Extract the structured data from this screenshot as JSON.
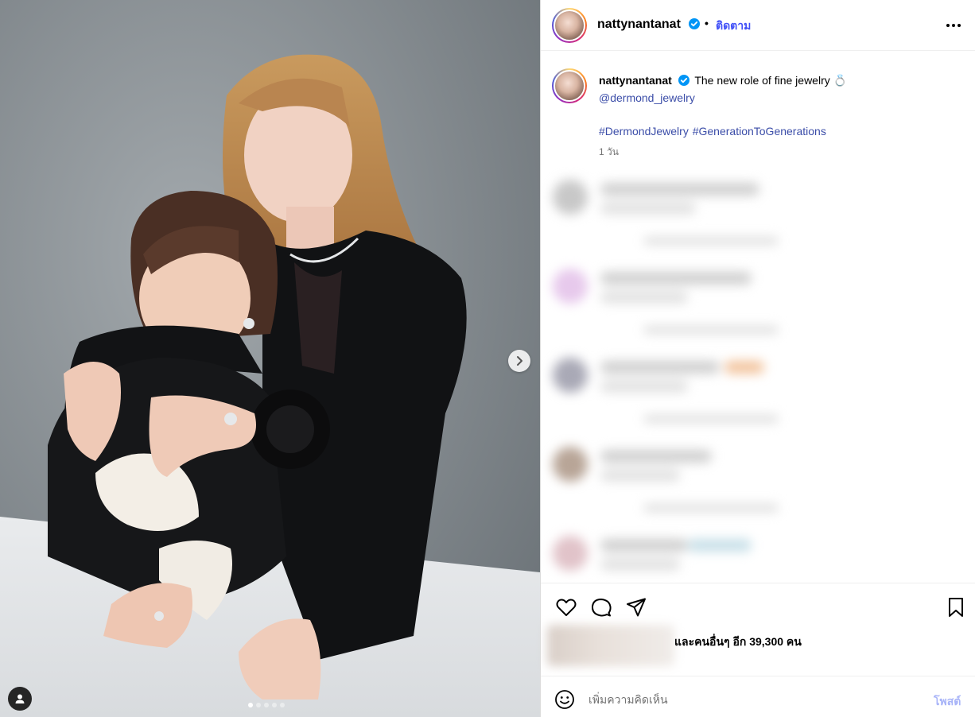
{
  "post": {
    "media": {
      "slide_count": 5,
      "active_slide": 1,
      "next_icon": "chevron-right-icon",
      "tag_icon": "user-icon"
    },
    "header": {
      "username": "nattynantanat",
      "verified_icon": "verified-badge-icon",
      "separator": "•",
      "follow_label": "ติดตาม",
      "more_icon": "more-horizontal-icon"
    },
    "caption": {
      "username": "nattynantanat",
      "text": "The new role of fine jewelry 💍",
      "mention": "@dermond_jewelry",
      "hashtags": [
        "#DermondJewelry",
        "#GenerationToGenerations"
      ],
      "timestamp": "1 วัน"
    },
    "actions": {
      "like_icon": "heart-icon",
      "comment_icon": "comment-icon",
      "share_icon": "send-icon",
      "save_icon": "bookmark-icon"
    },
    "likes": {
      "text": "และคนอื่นๆ อีก 39,300 คน"
    },
    "comment_box": {
      "emoji_icon": "emoji-icon",
      "placeholder": "เพิ่มความคิดเห็น",
      "post_label": "โพสต์"
    }
  },
  "colors": {
    "accent_blue": "#4150f7",
    "link_blue": "#3b4da8",
    "muted_text": "#737373",
    "post_disabled": "#a8b4f8",
    "border": "#dbdbdb"
  }
}
